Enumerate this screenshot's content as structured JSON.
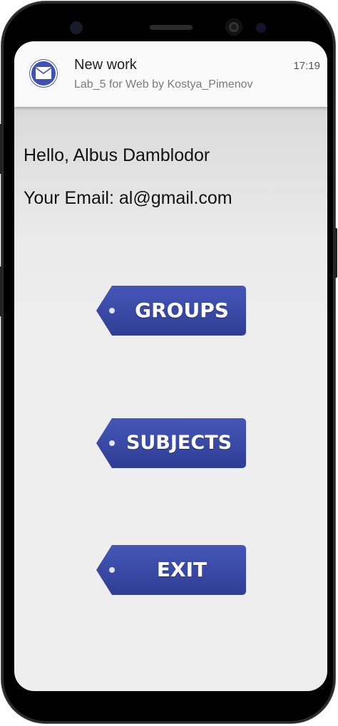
{
  "notification": {
    "title": "New work",
    "subtitle": "Lab_5 for Web by Kostya_Pimenov",
    "time": "17:19",
    "icon": "mail-icon",
    "accent": "#4051b5"
  },
  "appbar": {
    "color": "#2e3c8c"
  },
  "profile": {
    "greeting": "Hello, Albus Damblodor",
    "email": "Your Email: al@gmail.com"
  },
  "menu": {
    "button_color": "#3a4aa6",
    "items": [
      {
        "label": "GROUPS"
      },
      {
        "label": "SUBJECTS"
      },
      {
        "label": "EXIT"
      }
    ]
  }
}
